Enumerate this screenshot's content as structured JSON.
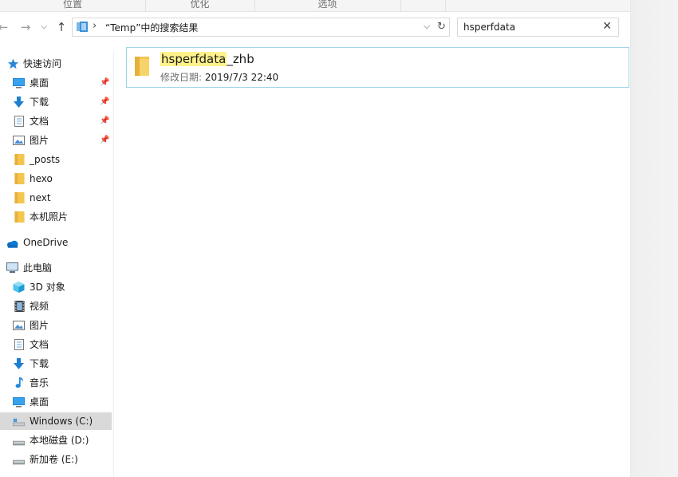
{
  "ribbon": {
    "groups": [
      "位置",
      "优化",
      "选项"
    ]
  },
  "navigation": {
    "back_icon": "arrow-left-icon",
    "forward_icon": "arrow-right-icon",
    "recent_icon": "chevron-down-icon",
    "up_icon": "arrow-up-icon"
  },
  "address": {
    "chevron": "›",
    "path": "“Temp”中的搜索结果",
    "dropdown": "⌵",
    "refresh": "↻"
  },
  "search": {
    "value": "hsperfdata",
    "clear": "✕"
  },
  "sidebar": {
    "quick_access": {
      "label": "快速访问",
      "items": [
        {
          "label": "桌面",
          "icon": "desktop-icon",
          "pinned": true
        },
        {
          "label": "下载",
          "icon": "download-icon",
          "pinned": true
        },
        {
          "label": "文档",
          "icon": "document-icon",
          "pinned": true
        },
        {
          "label": "图片",
          "icon": "pictures-icon",
          "pinned": true
        },
        {
          "label": "_posts",
          "icon": "folder-icon",
          "pinned": false
        },
        {
          "label": "hexo",
          "icon": "folder-icon",
          "pinned": false
        },
        {
          "label": "next",
          "icon": "folder-icon",
          "pinned": false
        },
        {
          "label": "本机照片",
          "icon": "folder-icon",
          "pinned": false
        }
      ]
    },
    "onedrive": {
      "label": "OneDrive"
    },
    "this_pc": {
      "label": "此电脑",
      "items": [
        {
          "label": "3D 对象",
          "icon": "3d-objects-icon"
        },
        {
          "label": "视频",
          "icon": "video-icon"
        },
        {
          "label": "图片",
          "icon": "pictures-icon"
        },
        {
          "label": "文档",
          "icon": "document-icon"
        },
        {
          "label": "下载",
          "icon": "download-icon"
        },
        {
          "label": "音乐",
          "icon": "music-icon"
        },
        {
          "label": "桌面",
          "icon": "desktop-icon"
        },
        {
          "label": "Windows (C:)",
          "icon": "windows-drive-icon",
          "selected": true
        },
        {
          "label": "本地磁盘 (D:)",
          "icon": "drive-icon"
        },
        {
          "label": "新加卷 (E:)",
          "icon": "drive-icon"
        }
      ]
    }
  },
  "results": [
    {
      "name_match": "hsperfdata",
      "name_rest": "_zhb",
      "modified_label": "修改日期:",
      "modified_value": "2019/7/3 22:40"
    }
  ],
  "colors": {
    "accent": "#1a8ad4",
    "folder": "#f5c64e",
    "highlight": "#fff28a",
    "selection": "#d9d9d9",
    "result_border": "#9fd4e8"
  }
}
